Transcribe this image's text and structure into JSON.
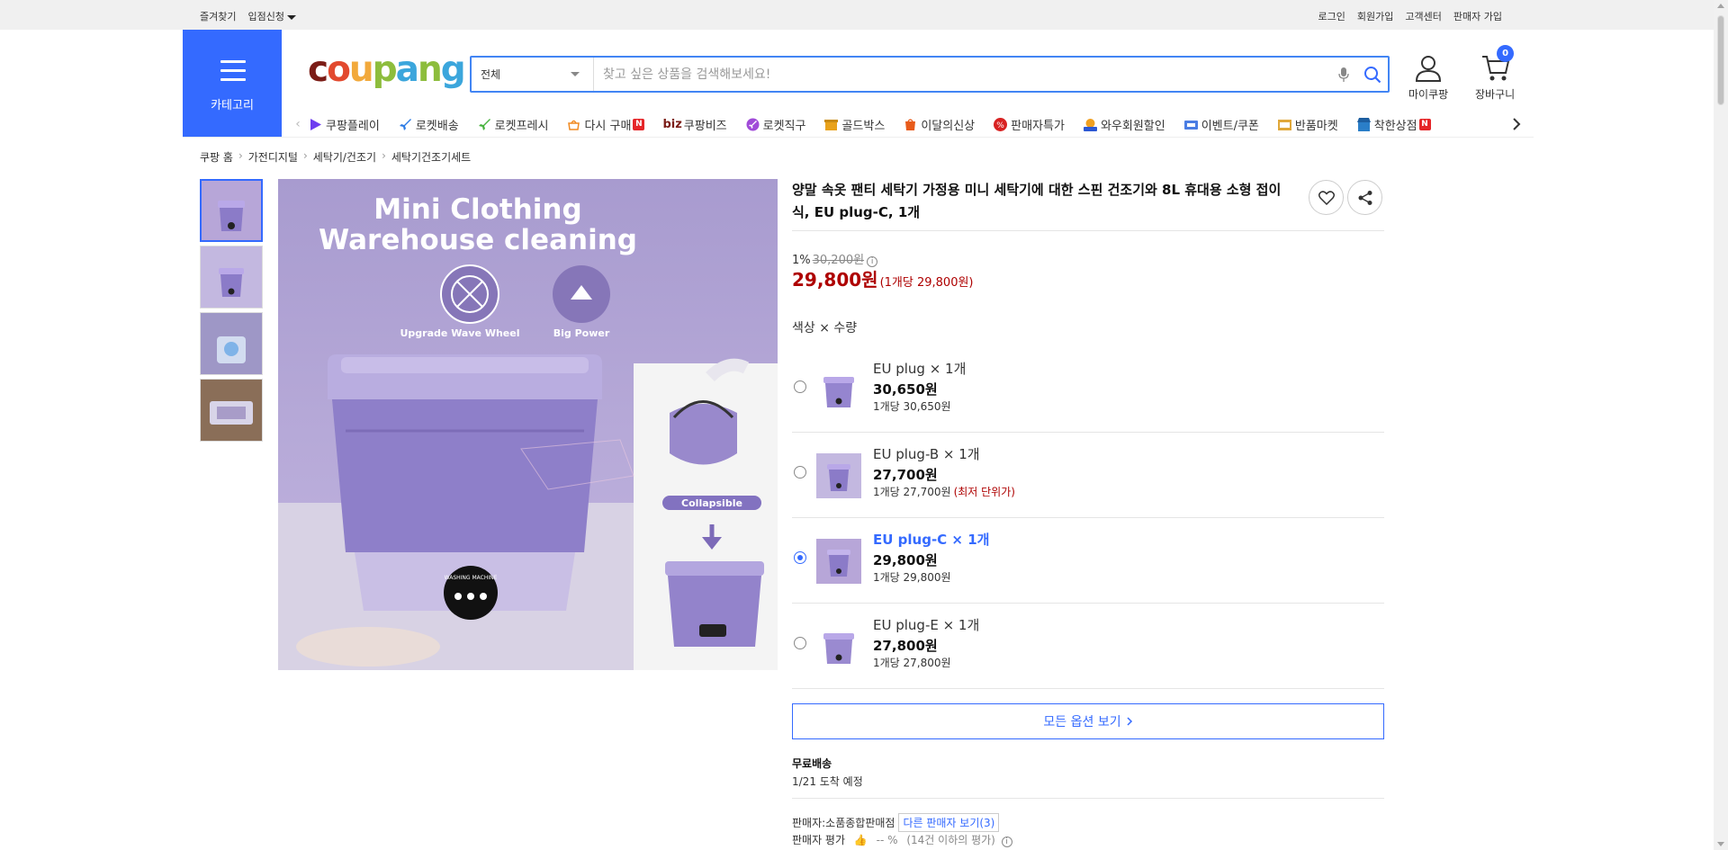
{
  "topbar": {
    "left": [
      "즐겨찾기",
      "입점신청"
    ],
    "right": [
      "로그인",
      "회원가입",
      "고객센터",
      "판매자 가입"
    ]
  },
  "header": {
    "category_label": "카테고리",
    "logo_text": "coupang",
    "search_scope": "전체",
    "search_placeholder": "찾고 싶은 상품을 검색해보세요!",
    "mypage_label": "마이쿠팡",
    "cart_label": "장바구니",
    "cart_count": "0"
  },
  "nav": {
    "items": [
      {
        "label": "쿠팡플레이",
        "icon": "coupang-play-icon",
        "color": "#6e3df0"
      },
      {
        "label": "로켓배송",
        "icon": "rocket-icon",
        "color": "#2d7be5"
      },
      {
        "label": "로켓프레시",
        "icon": "rocket-fresh-icon",
        "color": "#48b33f"
      },
      {
        "label": "다시 구매",
        "icon": "rebuy-icon",
        "color": "#f08a22",
        "badge": "N"
      },
      {
        "label": "쿠팡비즈",
        "prefix": "biz",
        "icon": "biz-icon",
        "color": "#7b1c16"
      },
      {
        "label": "로켓직구",
        "icon": "rocket-global-icon",
        "color": "#a04bd8"
      },
      {
        "label": "골드박스",
        "icon": "goldbox-icon",
        "color": "#e9a21b"
      },
      {
        "label": "이달의신상",
        "icon": "new-icon",
        "color": "#e85b1a"
      },
      {
        "label": "판매자특가",
        "icon": "percent-icon",
        "color": "#d82222"
      },
      {
        "label": "와우회원할인",
        "icon": "wow-icon",
        "color": "#2c58d3"
      },
      {
        "label": "이벤트/쿠폰",
        "icon": "coupon-icon",
        "color": "#4a7de3"
      },
      {
        "label": "반품마켓",
        "icon": "return-market-icon",
        "color": "#e0a83a"
      },
      {
        "label": "착한상점",
        "icon": "good-store-icon",
        "color": "#2a7ec8",
        "badge": "N"
      }
    ]
  },
  "breadcrumb": [
    "쿠팡 홈",
    "가전디지털",
    "세탁기/건조기",
    "세탁기건조기세트"
  ],
  "product": {
    "title": "양말 속옷 팬티 세탁기 가정용 미니 세탁기에 대한 스핀 건조기와 8L 휴대용 소형 접이식, EU plug-C, 1개",
    "discount": "1%",
    "original_price": "30,200원",
    "price": "29,800원",
    "unit_price": "(1개당 29,800원)",
    "option_label": "색상 × 수량",
    "image_text": {
      "headline1": "Mini Clothing",
      "headline2": "Warehouse cleaning",
      "feature1": "Upgrade Wave Wheel",
      "feature2": "Big Power",
      "collapsible": "Collapsible",
      "panel": "WASHING MACHINE"
    },
    "options": [
      {
        "name": "EU plug × 1개",
        "price": "30,650원",
        "unit": "1개당 30,650원",
        "selected": false
      },
      {
        "name": "EU plug-B × 1개",
        "price": "27,700원",
        "unit": "1개당 27,700원",
        "note": "(최저 단위가)",
        "selected": false
      },
      {
        "name": "EU plug-C × 1개",
        "price": "29,800원",
        "unit": "1개당 29,800원",
        "selected": true
      },
      {
        "name": "EU plug-E × 1개",
        "price": "27,800원",
        "unit": "1개당 27,800원",
        "selected": false
      }
    ],
    "all_options_label": "모든 옵션 보기",
    "shipping": "무료배송",
    "arrival": "1/21 도착 예정",
    "seller_label": "판매자:",
    "seller_name": "소품종합판매점",
    "other_sellers": "다른 판매자 보기(3)",
    "seller_rating_label": "판매자 평가",
    "seller_rating": "-- %",
    "seller_rating_note": "(14건 이하의 평가)"
  },
  "colors": {
    "accent": "#346aff",
    "price_red": "#ae0000",
    "product_purple": "#9d8ed0"
  }
}
